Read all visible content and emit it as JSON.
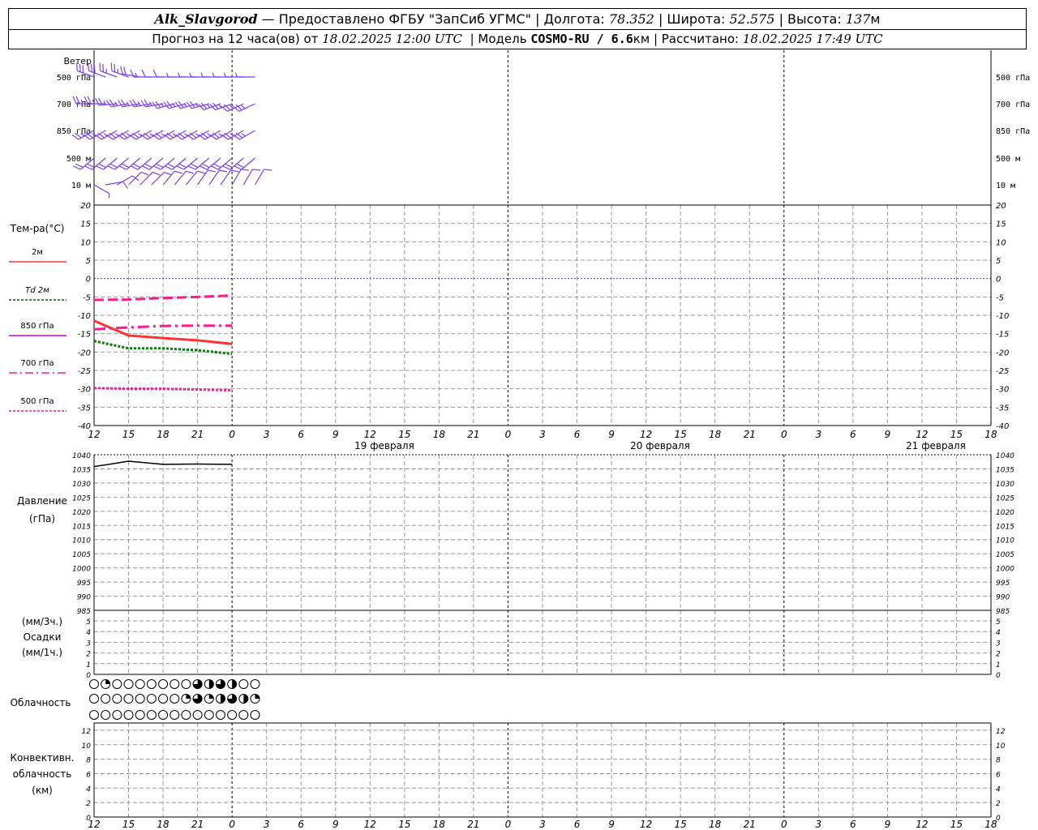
{
  "header": {
    "station": "Alk_Slavgorod",
    "provider": "— Предоставлено ФГБУ \"ЗапСиб УГМС\" | Долгота:",
    "lon": "78.352",
    "lat_label": "| Широта:",
    "lat": "52.575",
    "alt_label": "| Высота:",
    "alt": "137",
    "alt_unit": "м",
    "forecast_label": "Прогноз на 12 часа(ов) от",
    "forecast_time": "18.02.2025 12:00 UTC",
    "model_label": "| Модель",
    "model": "COSMO-RU / 6.6",
    "model_unit": "км",
    "calc_label": "| Рассчитано:",
    "calc_time": "18.02.2025 17:49 UTC"
  },
  "labels": {
    "wind": "Ветер",
    "wind_levels": [
      "500 гПа",
      "700 гПа",
      "850 гПа",
      "500 м",
      "10  м"
    ],
    "temp_title": "Тем-ра(°C)",
    "temp_legend": [
      {
        "text": "2м",
        "color": "#ff3333",
        "dash": ""
      },
      {
        "text": "Td  2м",
        "color": "#006600",
        "dash": "3,2"
      },
      {
        "text": "850 гПа",
        "color": "#cc00cc",
        "dash": ""
      },
      {
        "text": "700 гПа",
        "color": "#ff1a8c",
        "dash": "10,4,2,4"
      },
      {
        "text": "500 гПа",
        "color": "#ff1a8c",
        "dash": "3,2"
      }
    ],
    "pressure_title": "Давление",
    "pressure_unit": "(гПа)",
    "precip_top": "(мм/3ч.)",
    "precip_title": "Осадки",
    "precip_bottom": "(мм/1ч.)",
    "cloud_title": "Облачность",
    "conv_title_1": "Конвективн.",
    "conv_title_2": "облачность",
    "conv_unit": "(км)"
  },
  "time_axis": {
    "tick_labels": [
      "12",
      "15",
      "18",
      "21",
      "0",
      "3",
      "6",
      "9",
      "12",
      "15",
      "18",
      "21",
      "0",
      "3",
      "6",
      "9",
      "12",
      "15",
      "18",
      "21",
      "0",
      "3",
      "6",
      "9",
      "12",
      "15",
      "18"
    ],
    "date_labels": [
      "19 февраля",
      "20 февраля",
      "21 февраля"
    ]
  },
  "chart_data": [
    {
      "type": "line",
      "title": "Тем-ра(°C)",
      "x": [
        "18.02 12",
        "18.02 15",
        "18.02 18",
        "18.02 21",
        "19.02 00"
      ],
      "ylim": [
        -40,
        20
      ],
      "yticks": [
        20,
        15,
        10,
        5,
        0,
        -5,
        -10,
        -15,
        -20,
        -25,
        -30,
        -35,
        -40
      ],
      "series": [
        {
          "name": "2м",
          "values": [
            -11.5,
            -15.5,
            -16.2,
            -16.8,
            -17.8
          ]
        },
        {
          "name": "Td  2м",
          "values": [
            -17.0,
            -19.0,
            -19.0,
            -19.5,
            -20.5
          ]
        },
        {
          "name": "850 гПа",
          "values": [
            -5.8,
            -5.7,
            -5.3,
            -5.0,
            -4.6
          ]
        },
        {
          "name": "700 гПа",
          "values": [
            -13.8,
            -13.3,
            -12.9,
            -12.8,
            -12.8
          ]
        },
        {
          "name": "500 гПа",
          "values": [
            -29.8,
            -30.0,
            -30.0,
            -30.2,
            -30.4
          ]
        }
      ]
    },
    {
      "type": "line",
      "title": "Давление",
      "x": [
        "18.02 12",
        "18.02 15",
        "18.02 18",
        "18.02 21",
        "19.02 00"
      ],
      "ylim": [
        985,
        1040
      ],
      "yticks": [
        1040,
        1035,
        1030,
        1025,
        1020,
        1015,
        1010,
        1005,
        1000,
        995,
        990,
        985
      ],
      "series": [
        {
          "values": [
            1035.8,
            1037.7,
            1036.6,
            1036.7,
            1036.6
          ]
        }
      ]
    },
    {
      "type": "bar",
      "title": "Осадки",
      "ylim": [
        0,
        5
      ],
      "yticks": [
        5,
        4,
        3,
        2,
        1,
        0
      ],
      "right_yticks": [
        5,
        4,
        3,
        2,
        1,
        0
      ]
    },
    {
      "type": "table",
      "title": "Облачность",
      "rows": [
        [
          0,
          0.25,
          0,
          0,
          0,
          0,
          0,
          0,
          0,
          0.75,
          0.5,
          0.75,
          0.5,
          0,
          0
        ],
        [
          0,
          0,
          0,
          0,
          0,
          0,
          0,
          0,
          0.25,
          0.75,
          0.25,
          0.5,
          0.75,
          0.5,
          0.25
        ],
        [
          0,
          0,
          0,
          0,
          0,
          0,
          0,
          0,
          0,
          0,
          0,
          0,
          0,
          0,
          0
        ]
      ]
    },
    {
      "type": "bar",
      "title": "Конвективн. облачность",
      "ylim": [
        0,
        13
      ],
      "yticks": [
        12,
        10,
        8,
        6,
        4,
        2,
        0
      ]
    }
  ],
  "wind": {
    "rows": [
      {
        "level": "500 гПа",
        "dir": [
          290,
          290,
          290,
          290,
          280,
          270,
          270,
          270,
          270,
          270,
          270,
          270,
          270,
          270,
          270
        ],
        "spd": [
          30,
          30,
          28,
          25,
          22,
          15,
          10,
          10,
          8,
          5,
          5,
          5,
          5,
          5,
          5
        ]
      },
      {
        "level": "700 гПа",
        "dir": [
          270,
          270,
          265,
          260,
          260,
          260,
          260,
          255,
          255,
          255,
          255,
          250,
          250,
          245,
          245
        ],
        "spd": [
          25,
          25,
          25,
          25,
          25,
          25,
          25,
          25,
          25,
          25,
          25,
          25,
          25,
          25,
          25
        ]
      },
      {
        "level": "850 гПа",
        "dir": [
          240,
          240,
          240,
          240,
          240,
          240,
          240,
          240,
          240,
          240,
          240,
          240,
          240,
          240,
          240
        ],
        "spd": [
          25,
          25,
          25,
          25,
          25,
          25,
          25,
          25,
          25,
          25,
          25,
          25,
          25,
          25,
          25
        ]
      },
      {
        "level": "500 м",
        "dir": [
          230,
          230,
          230,
          230,
          230,
          230,
          230,
          230,
          230,
          230,
          230,
          230,
          230,
          230,
          230
        ],
        "spd": [
          20,
          20,
          20,
          20,
          20,
          20,
          20,
          20,
          20,
          20,
          20,
          20,
          20,
          20,
          20
        ]
      },
      {
        "level": "10  м",
        "dir": [
          120,
          80,
          60,
          45,
          45,
          45,
          40,
          40,
          40,
          35,
          35,
          35,
          30,
          30,
          30
        ],
        "spd": [
          5,
          10,
          10,
          10,
          10,
          10,
          10,
          10,
          10,
          10,
          10,
          10,
          10,
          10,
          10
        ]
      }
    ]
  },
  "colors": {
    "wind": "#7a3ff0",
    "zero": "#3333ff",
    "grid": "#999999",
    "pressure": "#000000"
  }
}
